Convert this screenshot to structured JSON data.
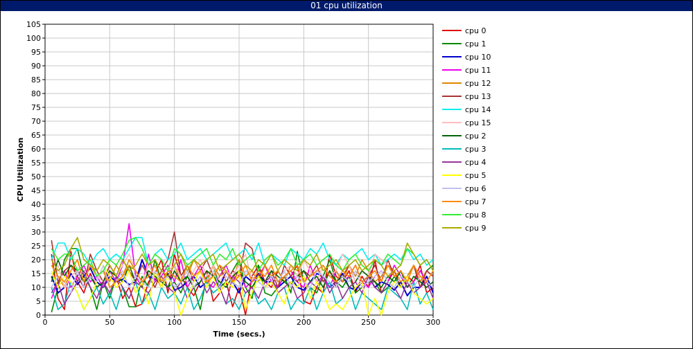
{
  "window": {
    "title": "01 cpu utilization"
  },
  "chart_data": {
    "type": "line",
    "title": "01 cpu utilization",
    "xlabel": "Time (secs.)",
    "ylabel": "CPU Utilization",
    "xlim": [
      0,
      300
    ],
    "ylim": [
      0,
      105
    ],
    "xticks": [
      0,
      50,
      100,
      150,
      200,
      250,
      300
    ],
    "yticks": [
      0,
      5,
      10,
      15,
      20,
      25,
      30,
      35,
      40,
      45,
      50,
      55,
      60,
      65,
      70,
      75,
      80,
      85,
      90,
      95,
      100,
      105
    ],
    "grid": true,
    "legend_position": "right",
    "x": [
      5,
      10,
      15,
      20,
      25,
      30,
      35,
      40,
      45,
      50,
      55,
      60,
      65,
      70,
      75,
      80,
      85,
      90,
      95,
      100,
      105,
      110,
      115,
      120,
      125,
      130,
      135,
      140,
      145,
      150,
      155,
      160,
      165,
      170,
      175,
      180,
      185,
      190,
      195,
      200,
      205,
      210,
      215,
      220,
      225,
      230,
      235,
      240,
      245,
      250,
      255,
      260,
      265,
      270,
      275,
      280,
      285,
      290,
      295,
      300
    ],
    "series": [
      {
        "name": "cpu 0",
        "color": "#dd0000",
        "values": [
          22,
          6,
          2,
          23,
          12,
          8,
          15,
          10,
          12,
          18,
          14,
          6,
          10,
          3,
          4,
          12,
          15,
          20,
          8,
          22,
          14,
          10,
          7,
          12,
          16,
          5,
          8,
          12,
          3,
          10,
          0,
          14,
          18,
          12,
          10,
          16,
          12,
          14,
          18,
          5,
          4,
          10,
          8,
          22,
          14,
          12,
          16,
          8,
          14,
          10,
          20,
          8,
          12,
          16,
          10,
          14,
          12,
          18,
          8,
          10
        ]
      },
      {
        "name": "cpu 1",
        "color": "#008800",
        "values": [
          1,
          10,
          20,
          24,
          24,
          14,
          10,
          2,
          12,
          6,
          14,
          10,
          3,
          3,
          14,
          10,
          20,
          12,
          10,
          12,
          8,
          14,
          10,
          2,
          14,
          18,
          10,
          12,
          16,
          20,
          10,
          6,
          18,
          8,
          7,
          10,
          14,
          8,
          23,
          12,
          10,
          8,
          14,
          20,
          12,
          10,
          14,
          8,
          10,
          12,
          12,
          8,
          10,
          14,
          10,
          14,
          18,
          12,
          16,
          18
        ]
      },
      {
        "name": "cpu 10",
        "color": "#0000cc",
        "values": [
          14,
          8,
          10,
          15,
          11,
          14,
          17,
          12,
          10,
          14,
          12,
          13,
          11,
          12,
          20,
          14,
          13,
          12,
          15,
          9,
          10,
          12,
          14,
          10,
          12,
          14,
          10,
          16,
          12,
          8,
          14,
          12,
          15,
          12,
          12,
          10,
          12,
          14,
          10,
          9,
          12,
          15,
          14,
          10,
          12,
          15,
          10,
          9,
          12,
          14,
          10,
          12,
          11,
          9,
          12,
          7,
          10,
          10,
          14,
          8
        ]
      },
      {
        "name": "cpu 11",
        "color": "#ee00ee",
        "values": [
          6,
          12,
          16,
          10,
          14,
          18,
          12,
          14,
          10,
          16,
          12,
          18,
          33,
          14,
          10,
          22,
          12,
          14,
          18,
          12,
          20,
          10,
          14,
          18,
          12,
          10,
          14,
          18,
          12,
          16,
          10,
          12,
          14,
          18,
          12,
          10,
          14,
          16,
          12,
          10,
          18,
          12,
          14,
          10,
          16,
          12,
          14,
          18,
          12,
          10,
          14,
          16,
          12,
          18,
          14,
          10,
          12,
          16,
          12,
          10
        ]
      },
      {
        "name": "cpu 12",
        "color": "#dd8800",
        "values": [
          18,
          14,
          10,
          16,
          20,
          12,
          18,
          14,
          16,
          12,
          18,
          14,
          20,
          16,
          12,
          18,
          14,
          10,
          16,
          18,
          12,
          14,
          20,
          16,
          12,
          18,
          14,
          16,
          12,
          20,
          14,
          16,
          12,
          18,
          14,
          16,
          12,
          18,
          14,
          20,
          16,
          12,
          18,
          14,
          16,
          12,
          18,
          14,
          20,
          16,
          12,
          14,
          18,
          16,
          12,
          14,
          18,
          12,
          16,
          14
        ]
      },
      {
        "name": "cpu 13",
        "color": "#aa3333",
        "values": [
          27,
          12,
          16,
          18,
          14,
          10,
          22,
          16,
          12,
          18,
          14,
          20,
          16,
          12,
          18,
          14,
          10,
          16,
          20,
          30,
          14,
          18,
          12,
          16,
          20,
          14,
          18,
          12,
          16,
          14,
          26,
          24,
          14,
          12,
          16,
          10,
          18,
          14,
          12,
          16,
          14,
          18,
          12,
          16,
          10,
          14,
          18,
          12,
          16,
          14,
          18,
          12,
          20,
          14,
          16,
          12,
          18,
          10,
          16,
          14
        ]
      },
      {
        "name": "cpu 14",
        "color": "#00eeee",
        "values": [
          20,
          26,
          26,
          20,
          24,
          22,
          18,
          22,
          24,
          20,
          22,
          20,
          24,
          28,
          28,
          18,
          22,
          24,
          20,
          22,
          26,
          20,
          22,
          24,
          20,
          22,
          24,
          26,
          20,
          22,
          24,
          20,
          26,
          18,
          22,
          20,
          18,
          24,
          22,
          20,
          24,
          22,
          26,
          20,
          18,
          22,
          20,
          22,
          24,
          20,
          22,
          18,
          20,
          22,
          20,
          24,
          20,
          22,
          18,
          20
        ]
      },
      {
        "name": "cpu 15",
        "color": "#ffbbbb",
        "values": [
          14,
          18,
          10,
          14,
          16,
          12,
          18,
          14,
          12,
          16,
          14,
          18,
          22,
          16,
          12,
          18,
          14,
          12,
          16,
          18,
          14,
          12,
          16,
          20,
          14,
          18,
          12,
          16,
          14,
          18,
          22,
          12,
          16,
          14,
          18,
          12,
          16,
          18,
          14,
          20,
          16,
          12,
          18,
          14,
          16,
          22,
          18,
          12,
          16,
          14,
          22,
          20,
          18,
          14,
          16,
          12,
          18,
          14,
          12,
          16
        ]
      },
      {
        "name": "cpu 2",
        "color": "#006600",
        "values": [
          12,
          20,
          14,
          18,
          16,
          12,
          14,
          10,
          12,
          16,
          14,
          12,
          18,
          12,
          10,
          16,
          14,
          12,
          10,
          16,
          12,
          14,
          10,
          12,
          16,
          14,
          12,
          10,
          14,
          16,
          12,
          10,
          14,
          12,
          16,
          14,
          12,
          10,
          14,
          16,
          12,
          14,
          10,
          16,
          12,
          14,
          10,
          12,
          16,
          14,
          12,
          10,
          14,
          12,
          16,
          10,
          14,
          12,
          10,
          12
        ]
      },
      {
        "name": "cpu 3",
        "color": "#00bbbb",
        "values": [
          10,
          2,
          4,
          12,
          8,
          2,
          6,
          10,
          4,
          8,
          2,
          10,
          6,
          12,
          4,
          8,
          2,
          10,
          6,
          8,
          4,
          10,
          2,
          6,
          12,
          8,
          10,
          4,
          6,
          2,
          8,
          10,
          4,
          6,
          2,
          8,
          10,
          2,
          6,
          4,
          10,
          2,
          8,
          12,
          4,
          6,
          10,
          2,
          8,
          6,
          4,
          2,
          10,
          8,
          6,
          2,
          12,
          4,
          8,
          2
        ]
      },
      {
        "name": "cpu 4",
        "color": "#993399",
        "values": [
          8,
          12,
          4,
          8,
          12,
          16,
          10,
          6,
          12,
          8,
          14,
          10,
          6,
          12,
          10,
          8,
          12,
          14,
          10,
          8,
          12,
          6,
          10,
          14,
          8,
          12,
          10,
          4,
          14,
          12,
          8,
          10,
          6,
          12,
          14,
          8,
          10,
          12,
          6,
          8,
          12,
          10,
          14,
          8,
          12,
          6,
          10,
          12,
          8,
          14,
          10,
          8,
          12,
          10,
          6,
          12,
          8,
          10,
          12,
          6
        ]
      },
      {
        "name": "cpu 5",
        "color": "#ffff00",
        "values": [
          16,
          10,
          14,
          12,
          8,
          2,
          6,
          12,
          18,
          14,
          10,
          12,
          16,
          8,
          12,
          4,
          16,
          10,
          14,
          8,
          0,
          6,
          12,
          16,
          10,
          14,
          8,
          12,
          10,
          16,
          2,
          8,
          14,
          10,
          12,
          8,
          4,
          12,
          10,
          14,
          6,
          12,
          8,
          2,
          4,
          2,
          6,
          10,
          12,
          0,
          6,
          0,
          8,
          12,
          10,
          14,
          8,
          6,
          4,
          6
        ]
      },
      {
        "name": "cpu 6",
        "color": "#c0c0f0",
        "values": [
          10,
          14,
          12,
          8,
          16,
          10,
          14,
          12,
          18,
          10,
          12,
          16,
          10,
          14,
          12,
          10,
          16,
          12,
          14,
          10,
          12,
          16,
          10,
          14,
          12,
          16,
          10,
          14,
          12,
          10,
          16,
          14,
          12,
          10,
          14,
          12,
          16,
          10,
          14,
          12,
          10,
          16,
          14,
          12,
          10,
          14,
          12,
          16,
          10,
          12,
          14,
          16,
          12,
          10,
          14,
          12,
          10,
          14,
          12,
          10
        ]
      },
      {
        "name": "cpu 7",
        "color": "#ff8800",
        "values": [
          18,
          14,
          12,
          16,
          20,
          12,
          18,
          14,
          16,
          10,
          12,
          14,
          18,
          16,
          12,
          14,
          18,
          12,
          16,
          14,
          12,
          18,
          14,
          16,
          12,
          14,
          18,
          16,
          12,
          14,
          18,
          12,
          16,
          14,
          18,
          12,
          14,
          16,
          18,
          12,
          14,
          16,
          18,
          14,
          12,
          16,
          14,
          18,
          12,
          14,
          16,
          12,
          18,
          14,
          16,
          12,
          18,
          14,
          12,
          16
        ]
      },
      {
        "name": "cpu 8",
        "color": "#33ee33",
        "values": [
          24,
          20,
          22,
          22,
          16,
          18,
          20,
          14,
          16,
          20,
          18,
          22,
          27,
          28,
          24,
          18,
          22,
          20,
          16,
          24,
          22,
          18,
          20,
          22,
          24,
          18,
          22,
          20,
          24,
          18,
          20,
          22,
          16,
          20,
          22,
          18,
          20,
          24,
          18,
          20,
          22,
          18,
          20,
          22,
          18,
          16,
          20,
          22,
          18,
          16,
          20,
          18,
          22,
          20,
          18,
          24,
          22,
          18,
          20,
          16
        ]
      },
      {
        "name": "cpu 9",
        "color": "#aaaa00",
        "values": [
          20,
          16,
          18,
          24,
          28,
          20,
          18,
          16,
          20,
          18,
          14,
          20,
          16,
          18,
          22,
          18,
          20,
          16,
          14,
          18,
          22,
          16,
          20,
          18,
          20,
          22,
          16,
          18,
          20,
          22,
          18,
          16,
          20,
          18,
          22,
          16,
          20,
          18,
          16,
          20,
          18,
          22,
          16,
          18,
          20,
          16,
          18,
          20,
          16,
          18,
          20,
          18,
          14,
          16,
          18,
          26,
          22,
          18,
          20,
          16
        ]
      }
    ]
  }
}
